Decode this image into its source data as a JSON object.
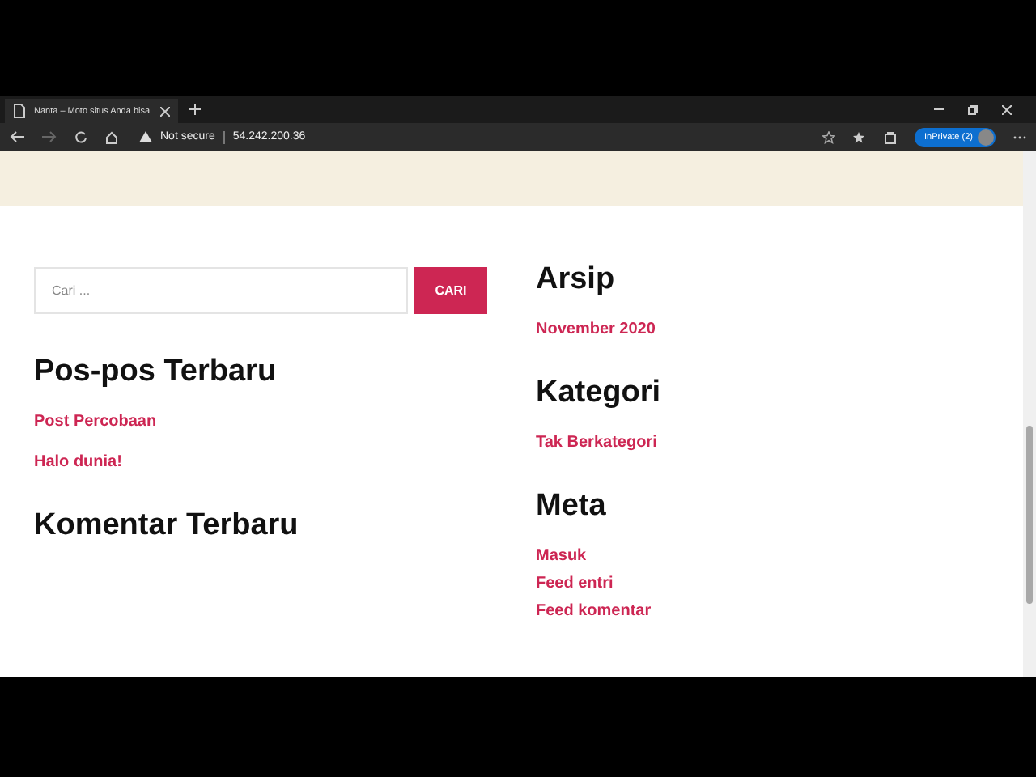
{
  "browser": {
    "tab": {
      "title": "Nanta – Moto situs Anda bisa",
      "selected": true
    },
    "address": {
      "security": "Not secure",
      "url": "54.242.200.36"
    },
    "profile": {
      "label": "InPrivate (2)"
    }
  },
  "left": {
    "search": {
      "placeholder": "Cari ...",
      "button": "CARI"
    },
    "widgets": [
      {
        "title": "Pos-pos Terbaru",
        "links": [
          "Post Percobaan",
          "Halo dunia!"
        ]
      },
      {
        "title": "Komentar Terbaru"
      }
    ]
  },
  "right": {
    "widgets": [
      {
        "title": "Arsip",
        "links": [
          "November 2020"
        ]
      },
      {
        "title": "Kategori",
        "links": [
          "Tak Berkategori"
        ]
      },
      {
        "title": "Meta",
        "kind": "compact",
        "links": [
          "Masuk",
          "Feed entri",
          "Feed komentar"
        ]
      }
    ]
  }
}
